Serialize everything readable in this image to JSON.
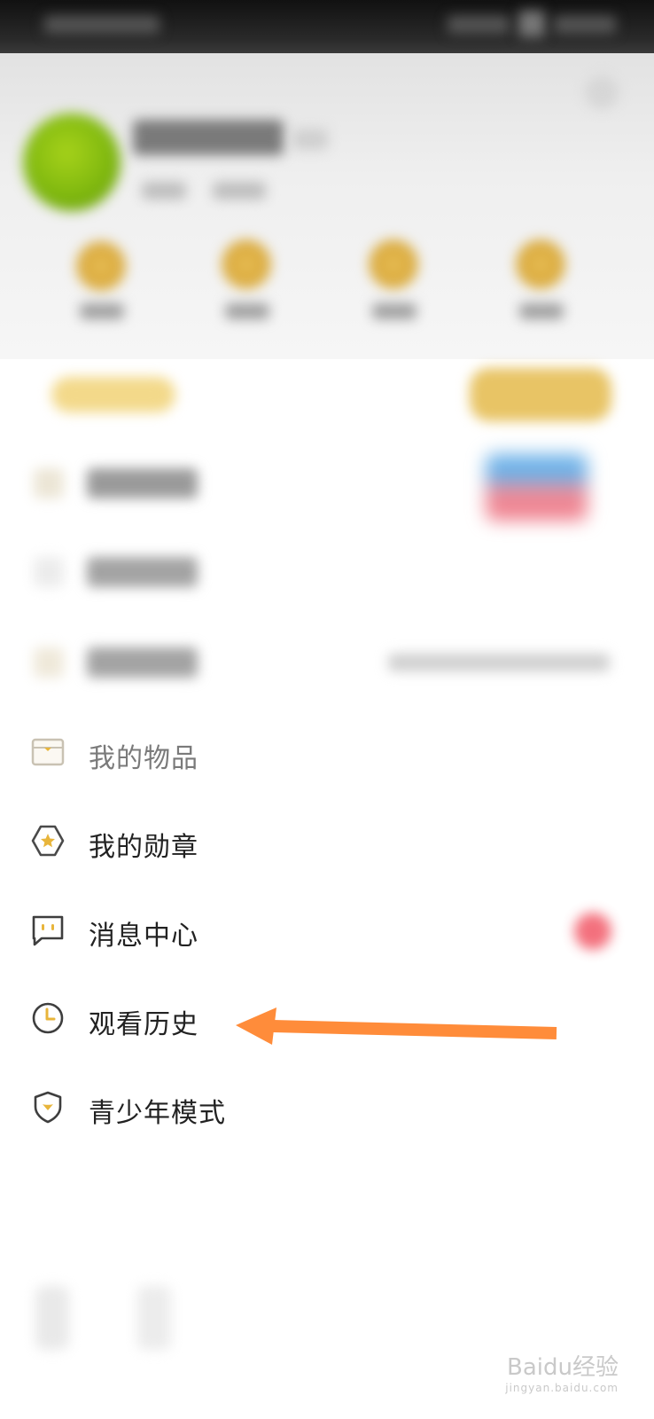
{
  "menu": {
    "items": [
      {
        "label": "我的物品",
        "icon": "box-icon"
      },
      {
        "label": "我的勋章",
        "icon": "medal-icon"
      },
      {
        "label": "消息中心",
        "icon": "message-icon"
      },
      {
        "label": "观看历史",
        "icon": "clock-icon"
      },
      {
        "label": "青少年模式",
        "icon": "shield-icon"
      }
    ]
  },
  "colors": {
    "accent_gold": "#e8b53b",
    "annotation_arrow": "#ff8c3a",
    "notification_red": "#f2616f"
  },
  "watermark": {
    "logo_text": "Baidu经验",
    "sub_text": "jingyan.baidu.com"
  }
}
